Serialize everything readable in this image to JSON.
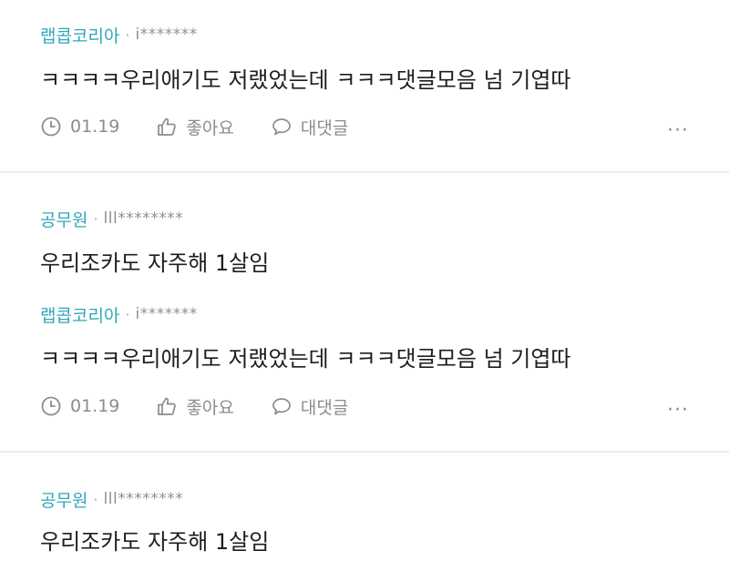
{
  "comments": [
    {
      "nickname": "랩콥코리아",
      "separator": "·",
      "user_id": "i*******",
      "text": "ㅋㅋㅋㅋ우리애기도 저랬었는데 ㅋㅋㅋ댓글모음 넘 기엽따",
      "date": "01.19",
      "like_label": "좋아요",
      "reply_label": "대댓글",
      "more_label": "···"
    },
    {
      "nickname": "공무원",
      "separator": "·",
      "user_id": "lll********",
      "text": "우리조카도 자주해 1살임"
    },
    {
      "nickname": "랩콥코리아",
      "separator": "·",
      "user_id": "i*******",
      "text": "ㅋㅋㅋㅋ우리애기도 저랬었는데 ㅋㅋㅋ댓글모음 넘 기엽따",
      "date": "01.19",
      "like_label": "좋아요",
      "reply_label": "대댓글",
      "more_label": "···"
    },
    {
      "nickname": "공무원",
      "separator": "·",
      "user_id": "lll********",
      "text": "우리조카도 자주해 1살임"
    }
  ]
}
